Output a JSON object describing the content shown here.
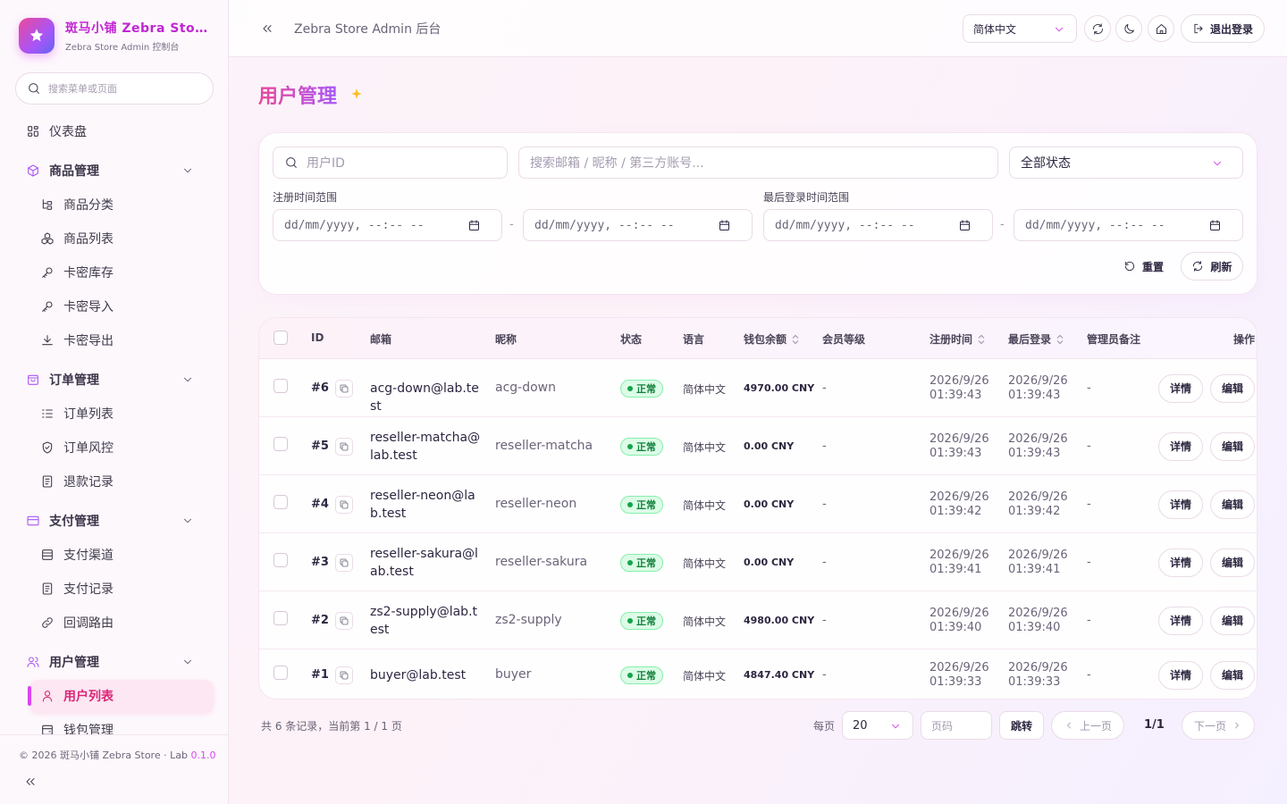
{
  "brand": {
    "name": "斑马小铺 Zebra Store",
    "subtitle": "Zebra Store Admin 控制台"
  },
  "sidebar": {
    "search_placeholder": "搜索菜单或页面",
    "items": [
      {
        "label": "仪表盘",
        "type": "item",
        "icon": "dashboard-icon"
      },
      {
        "label": "商品管理",
        "type": "group",
        "icon": "cube-icon"
      },
      {
        "label": "商品分类",
        "type": "sub",
        "icon": "tree-icon"
      },
      {
        "label": "商品列表",
        "type": "sub",
        "icon": "boxes-icon"
      },
      {
        "label": "卡密库存",
        "type": "sub",
        "icon": "key-icon"
      },
      {
        "label": "卡密导入",
        "type": "sub",
        "icon": "key-icon"
      },
      {
        "label": "卡密导出",
        "type": "sub",
        "icon": "download-icon"
      },
      {
        "label": "订单管理",
        "type": "group",
        "icon": "bag-icon"
      },
      {
        "label": "订单列表",
        "type": "sub",
        "icon": "list-icon"
      },
      {
        "label": "订单风控",
        "type": "sub",
        "icon": "shield-icon"
      },
      {
        "label": "退款记录",
        "type": "sub",
        "icon": "doc-icon"
      },
      {
        "label": "支付管理",
        "type": "group",
        "icon": "card-icon"
      },
      {
        "label": "支付渠道",
        "type": "sub",
        "icon": "channel-icon"
      },
      {
        "label": "支付记录",
        "type": "sub",
        "icon": "doc-icon"
      },
      {
        "label": "回调路由",
        "type": "sub",
        "icon": "link-icon"
      },
      {
        "label": "用户管理",
        "type": "group",
        "icon": "users-icon"
      },
      {
        "label": "用户列表",
        "type": "sub",
        "icon": "user-icon",
        "active": true
      },
      {
        "label": "钱包管理",
        "type": "sub",
        "icon": "wallet-icon"
      }
    ],
    "copyright": "© 2026 斑马小铺 Zebra Store · Lab ",
    "version": "0.1.0"
  },
  "header": {
    "title": "Zebra Store Admin 后台",
    "language": "简体中文",
    "logout_label": "退出登录"
  },
  "page": {
    "title": "用户管理"
  },
  "filters": {
    "user_id_placeholder": "用户ID",
    "keyword_placeholder": "搜索邮箱 / 昵称 / 第三方账号...",
    "status_value": "全部状态",
    "register_range_label": "注册时间范围",
    "login_range_label": "最后登录时间范围",
    "date_placeholder": "dd/mm/yyyy, --:-- --",
    "range_separator": "-",
    "reset_label": "重置",
    "refresh_label": "刷新"
  },
  "table": {
    "columns": {
      "id": "ID",
      "email": "邮箱",
      "nickname": "昵称",
      "status": "状态",
      "language": "语言",
      "balance": "钱包余额",
      "level": "会员等级",
      "registered": "注册时间",
      "last_login": "最后登录",
      "note": "管理员备注",
      "actions": "操作"
    },
    "detail_label": "详情",
    "edit_label": "编辑",
    "rows": [
      {
        "id": "#6",
        "email": "acg-down@lab.test",
        "nickname": "acg-down",
        "status": "正常",
        "language": "简体中文",
        "balance": "4970.00 CNY",
        "level": "-",
        "reg_date": "2026/9/26",
        "reg_time": "01:39:43",
        "login_date": "2026/9/26",
        "login_time": "01:39:43",
        "note": "-"
      },
      {
        "id": "#5",
        "email": "reseller-matcha@lab.test",
        "nickname": "reseller-matcha",
        "status": "正常",
        "language": "简体中文",
        "balance": "0.00 CNY",
        "level": "-",
        "reg_date": "2026/9/26",
        "reg_time": "01:39:43",
        "login_date": "2026/9/26",
        "login_time": "01:39:43",
        "note": "-"
      },
      {
        "id": "#4",
        "email": "reseller-neon@lab.test",
        "nickname": "reseller-neon",
        "status": "正常",
        "language": "简体中文",
        "balance": "0.00 CNY",
        "level": "-",
        "reg_date": "2026/9/26",
        "reg_time": "01:39:42",
        "login_date": "2026/9/26",
        "login_time": "01:39:42",
        "note": "-"
      },
      {
        "id": "#3",
        "email": "reseller-sakura@lab.test",
        "nickname": "reseller-sakura",
        "status": "正常",
        "language": "简体中文",
        "balance": "0.00 CNY",
        "level": "-",
        "reg_date": "2026/9/26",
        "reg_time": "01:39:41",
        "login_date": "2026/9/26",
        "login_time": "01:39:41",
        "note": "-"
      },
      {
        "id": "#2",
        "email": "zs2-supply@lab.test",
        "nickname": "zs2-supply",
        "status": "正常",
        "language": "简体中文",
        "balance": "4980.00 CNY",
        "level": "-",
        "reg_date": "2026/9/26",
        "reg_time": "01:39:40",
        "login_date": "2026/9/26",
        "login_time": "01:39:40",
        "note": "-"
      },
      {
        "id": "#1",
        "email": "buyer@lab.test",
        "nickname": "buyer",
        "status": "正常",
        "language": "简体中文",
        "balance": "4847.40 CNY",
        "level": "-",
        "reg_date": "2026/9/26",
        "reg_time": "01:39:33",
        "login_date": "2026/9/26",
        "login_time": "01:39:33",
        "note": "-"
      }
    ]
  },
  "pagination": {
    "summary": "共 6 条记录，当前第 1 / 1 页",
    "per_page_label": "每页",
    "per_page_value": "20",
    "page_input_placeholder": "页码",
    "jump_label": "跳转",
    "prev_label": "上一页",
    "indicator": "1/1",
    "next_label": "下一页"
  },
  "colors": {
    "accent": "#d946ef",
    "accent_pink": "#ec4899",
    "status_ok": "#16a34a"
  }
}
